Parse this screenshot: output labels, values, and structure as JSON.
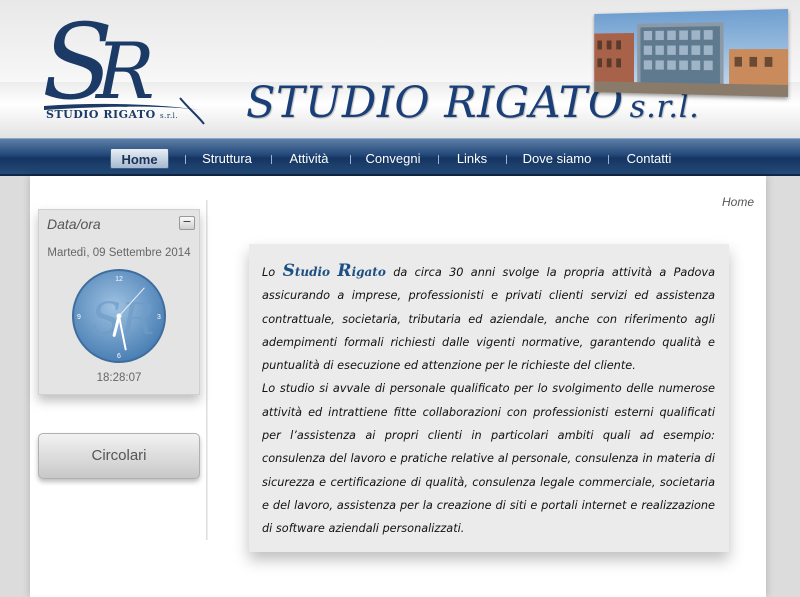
{
  "header": {
    "logo_monogram": "SR",
    "logo_text": "STUDIO RIGATO",
    "logo_text_suffix": "s.r.l.",
    "site_title": "STUDIO RIGATO",
    "site_title_suffix": "s.r.l."
  },
  "nav": {
    "items": [
      {
        "label": "Home",
        "active": true
      },
      {
        "label": "Struttura",
        "active": false
      },
      {
        "label": "Attività",
        "active": false
      },
      {
        "label": "Convegni",
        "active": false
      },
      {
        "label": "Links",
        "active": false
      },
      {
        "label": "Dove siamo",
        "active": false
      },
      {
        "label": "Contatti",
        "active": false
      }
    ]
  },
  "breadcrumb": "Home",
  "clock_widget": {
    "title": "Data/ora",
    "collapse_symbol": "−",
    "date": "Martedì, 09 Settembre 2014",
    "time": "18:28:07",
    "numerals": [
      "12",
      "3",
      "6",
      "9"
    ],
    "hour": 18,
    "minute": 28,
    "second": 7
  },
  "sidebar": {
    "circolari_label": "Circolari"
  },
  "main": {
    "intro_prefix": "Lo",
    "brand_s": "S",
    "brand_tudio": "tudio",
    "brand_r": "R",
    "brand_igato": "igato",
    "paragraph1_rest": "da circa 30 anni svolge la propria attività a Padova assicurando a imprese, professionisti e privati clienti servizi ed assistenza contrattuale, societaria, tributaria ed aziendale, anche con riferimento agli adempimenti formali richiesti dalle vigenti normative, garantendo qualità e puntualità di esecuzione ed attenzione per le richieste del cliente.",
    "paragraph2": "Lo studio si avvale di personale qualificato per lo svolgimento delle numerose attività ed intrattiene fitte collaborazioni con professionisti esterni qualificati per l’assistenza ai propri clienti in particolari ambiti quali ad esempio: consulenza del lavoro e pratiche relative al personale, consulenza in materia di sicurezza e certificazione di qualità, consulenza legale commerciale, societaria e del lavoro, assistenza per la creazione di siti e portali internet e realizzazione di software aziendali personalizzati."
  },
  "colors": {
    "brand_blue": "#1a3f78",
    "nav_blue": "#23497a",
    "clock_blue": "#4a7fb4"
  }
}
